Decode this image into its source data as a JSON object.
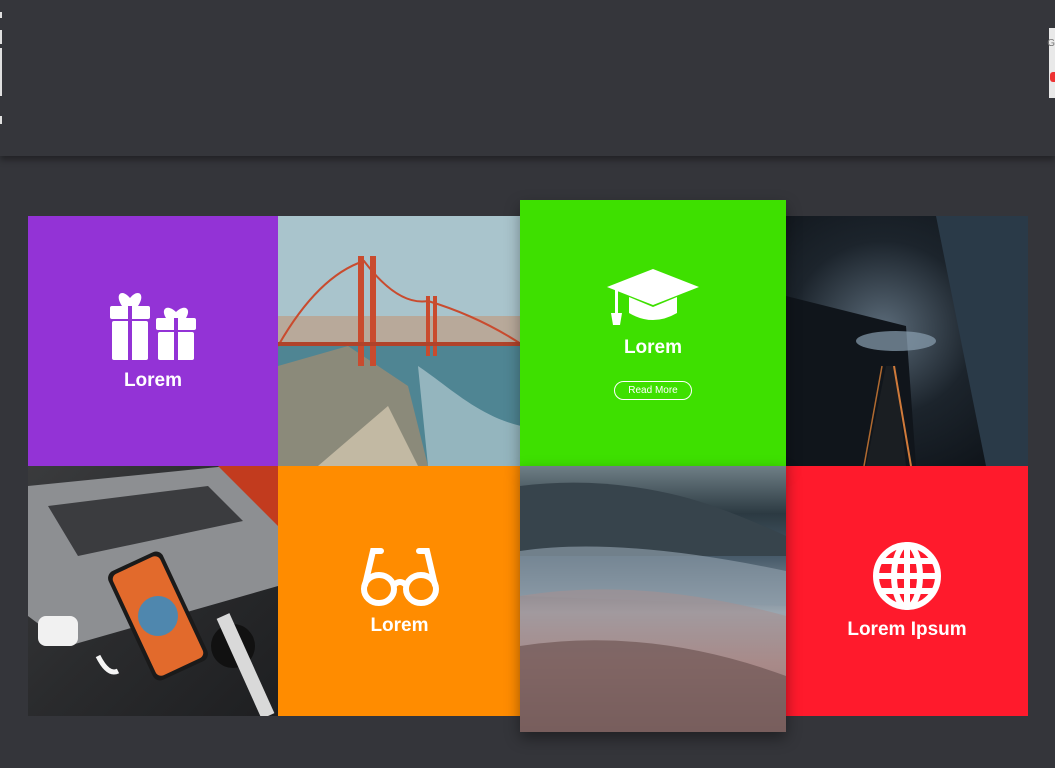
{
  "tiles": {
    "gift": {
      "label": "Lorem",
      "icon": "gift-icon",
      "color": "#9333d6"
    },
    "glasses": {
      "label": "Lorem",
      "icon": "glasses-icon",
      "color": "#ff8c00"
    },
    "globe": {
      "label": "Lorem Ipsum",
      "icon": "globe-icon",
      "color": "#ff1a2c"
    },
    "feature": {
      "label": "Lorem",
      "icon": "graduation-cap-icon",
      "button": "Read More",
      "color": "#3ee000"
    }
  },
  "photos": [
    "golden-gate-bridge",
    "dark-escalator",
    "laptop-phone-watch",
    "ocean-wave"
  ],
  "background": "#34353a"
}
